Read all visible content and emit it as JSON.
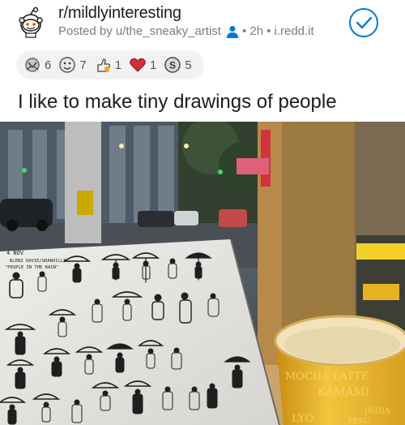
{
  "post": {
    "subreddit": "r/mildlyinteresting",
    "posted_by": "Posted by u/the_sneaky_artist",
    "age": "• 2h •",
    "domain": "i.redd.it",
    "title": "I like to make tiny drawings of people"
  },
  "awards": [
    {
      "icon": "silver-award-icon",
      "count": "6"
    },
    {
      "icon": "wholesome-award-icon",
      "count": "7"
    },
    {
      "icon": "helpful-award-icon",
      "count": "1"
    },
    {
      "icon": "heart-award-icon",
      "count": "1"
    },
    {
      "icon": "silver-coin-icon",
      "count": "5"
    }
  ],
  "sketchbook": {
    "date": "4 NOV",
    "location": "BLENZ DAVIE/GRANVILLE",
    "caption": "\"PEOPLE IN THE RAIN\""
  },
  "cup_text": {
    "line1": "MOCHA LATTE",
    "line2": "KAMAMI",
    "line3": "INDIA",
    "line4": "PERU",
    "line5": "LYO"
  },
  "colors": {
    "accent": "#0079d3",
    "mod": "#0079d3",
    "award_bg": "#f2f2f2",
    "cup_yellow": "#e8b72c"
  }
}
